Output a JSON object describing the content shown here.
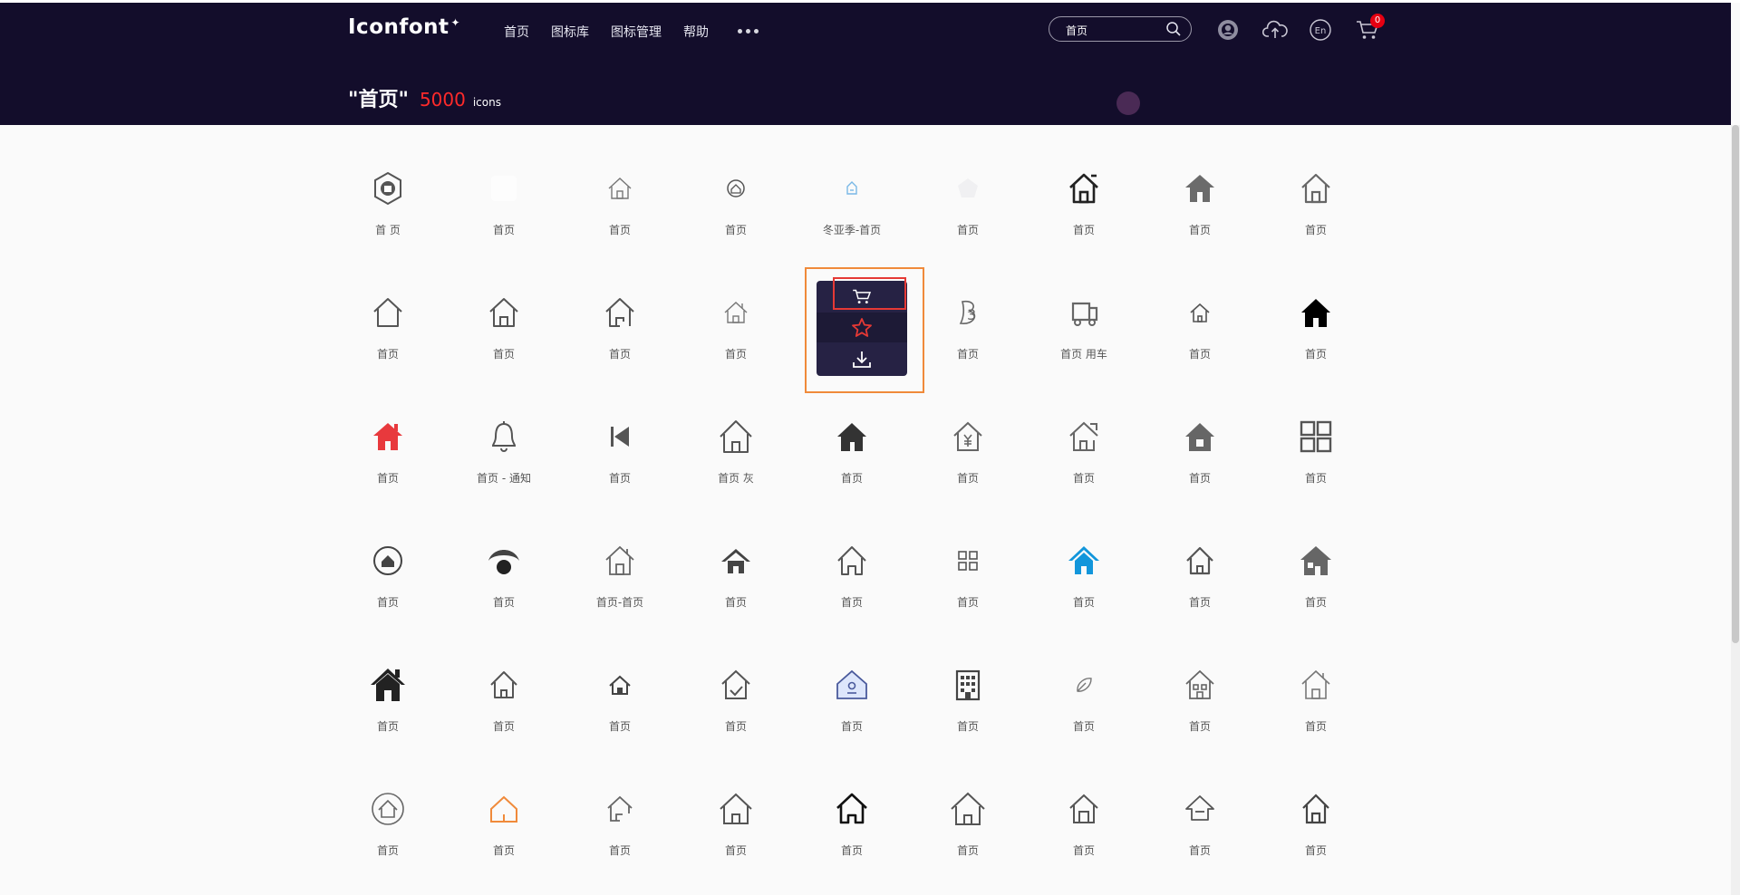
{
  "header": {
    "logo": "Iconfont",
    "nav": [
      {
        "label": "首页"
      },
      {
        "label": "图标库"
      },
      {
        "label": "图标管理"
      },
      {
        "label": "帮助"
      }
    ],
    "search": {
      "value": "首页"
    },
    "cart_count": "0",
    "lang": "En",
    "background": "#130d2b"
  },
  "result": {
    "query": "\"首页\"",
    "count": "5000",
    "unit": "icons",
    "count_color": "#ff2a2a"
  },
  "icons": [
    {
      "label": "首 页",
      "icon": "badge-hex-icon"
    },
    {
      "label": "首页",
      "icon": "blank-icon"
    },
    {
      "label": "首页",
      "icon": "house-thin-icon"
    },
    {
      "label": "首页",
      "icon": "circle-house-icon"
    },
    {
      "label": "冬亚季-首页",
      "icon": "small-blue-house-icon"
    },
    {
      "label": "首页",
      "icon": "faint-pentagon-icon"
    },
    {
      "label": "首页",
      "icon": "house-bold-outline-icon"
    },
    {
      "label": "首页",
      "icon": "house-filled-gray-icon"
    },
    {
      "label": "首页",
      "icon": "house-outline-icon"
    },
    {
      "label": "首页",
      "icon": "house-simple-icon"
    },
    {
      "label": "首页",
      "icon": "house-door-icon"
    },
    {
      "label": "首页",
      "icon": "house-open-icon"
    },
    {
      "label": "首页",
      "icon": "house-chimney-icon"
    },
    {
      "label": "",
      "icon": "hovered-cell"
    },
    {
      "label": "首页",
      "icon": "b-letter-icon"
    },
    {
      "label": "首页 用车",
      "icon": "truck-icon"
    },
    {
      "label": "首页",
      "icon": "house-small-icon"
    },
    {
      "label": "首页",
      "icon": "house-black-filled-icon"
    },
    {
      "label": "首页",
      "icon": "house-red-filled-icon"
    },
    {
      "label": "首页 - 通知",
      "icon": "bell-icon"
    },
    {
      "label": "首页",
      "icon": "skip-back-icon"
    },
    {
      "label": "首页 灰",
      "icon": "house-large-outline-icon"
    },
    {
      "label": "首页",
      "icon": "house-dark-filled-icon"
    },
    {
      "label": "首页",
      "icon": "house-yen-icon"
    },
    {
      "label": "首页",
      "icon": "house-arrow-icon"
    },
    {
      "label": "首页",
      "icon": "house-gray-solid-icon"
    },
    {
      "label": "首页",
      "icon": "grid-four-icon"
    },
    {
      "label": "首页",
      "icon": "circle-house-filled-icon"
    },
    {
      "label": "首页",
      "icon": "dome-dot-icon"
    },
    {
      "label": "首页-首页",
      "icon": "house-chimney-outline-icon"
    },
    {
      "label": "首页",
      "icon": "house-roof-filled-icon"
    },
    {
      "label": "首页",
      "icon": "house-curved-icon"
    },
    {
      "label": "首页",
      "icon": "grid-small-icon"
    },
    {
      "label": "首页",
      "icon": "house-blue-filled-icon"
    },
    {
      "label": "首页",
      "icon": "house-door-outline-icon"
    },
    {
      "label": "首页",
      "icon": "house-gray-window-icon"
    },
    {
      "label": "首页",
      "icon": "house-big-black-icon"
    },
    {
      "label": "首页",
      "icon": "house-line-icon"
    },
    {
      "label": "首页",
      "icon": "house-tiny-door-icon"
    },
    {
      "label": "首页",
      "icon": "house-check-icon"
    },
    {
      "label": "首页",
      "icon": "house-blue-person-icon"
    },
    {
      "label": "首页",
      "icon": "building-icon"
    },
    {
      "label": "首页",
      "icon": "leaf-small-icon"
    },
    {
      "label": "首页",
      "icon": "house-windows-icon"
    },
    {
      "label": "首页",
      "icon": "house-light-icon"
    },
    {
      "label": "首页",
      "icon": "circle-house-outline-icon"
    },
    {
      "label": "首页",
      "icon": "house-orange-icon"
    },
    {
      "label": "首页",
      "icon": "house-partial-icon"
    },
    {
      "label": "首页",
      "icon": "house-wide-icon"
    },
    {
      "label": "首页",
      "icon": "house-black-outline-icon"
    },
    {
      "label": "首页",
      "icon": "house-big-outline-icon"
    },
    {
      "label": "首页",
      "icon": "house-rect-door-icon"
    },
    {
      "label": "首页",
      "icon": "house-minus-icon"
    },
    {
      "label": "首页",
      "icon": "house-tall-icon"
    }
  ],
  "hover_actions": [
    {
      "name": "add-to-cart",
      "icon": "cart-icon"
    },
    {
      "name": "favorite",
      "icon": "star-icon",
      "color": "#e53935"
    },
    {
      "name": "download",
      "icon": "download-icon"
    }
  ]
}
